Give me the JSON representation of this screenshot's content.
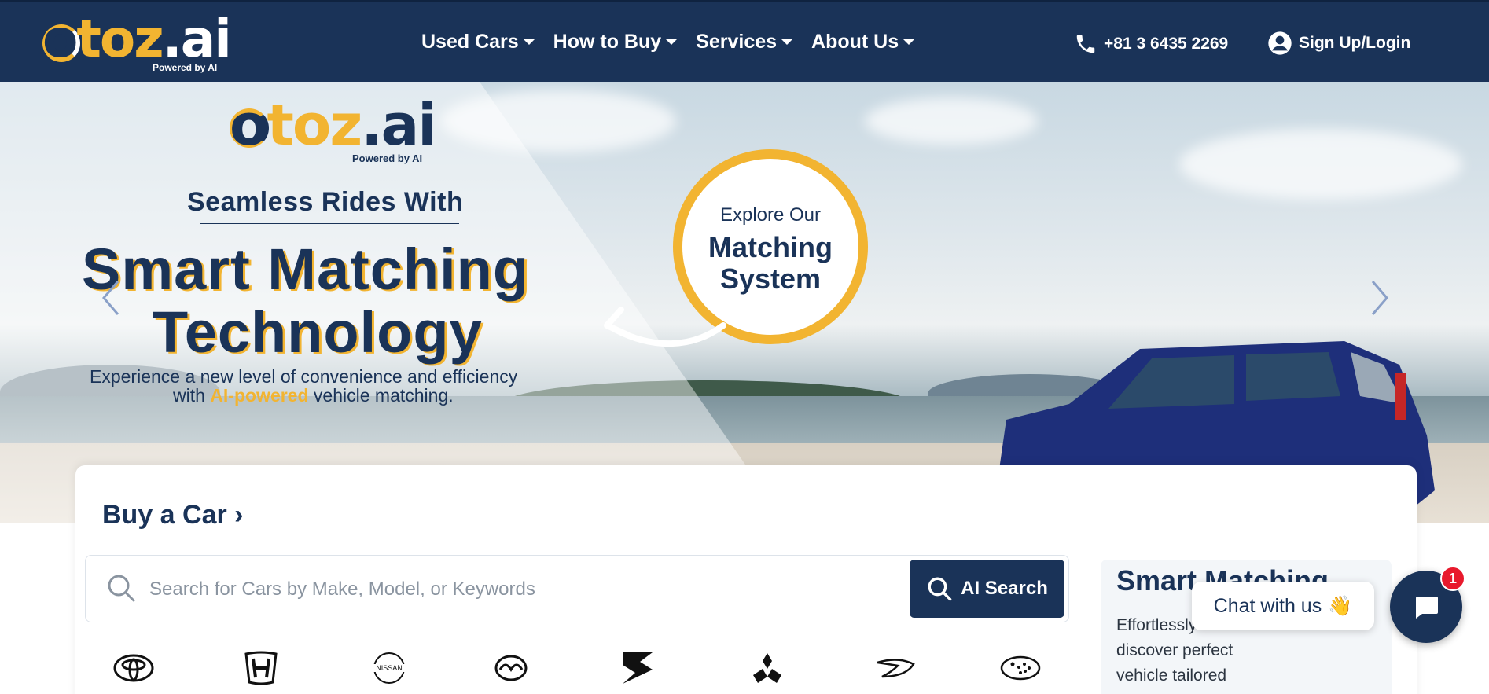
{
  "header": {
    "logo_main": "otoz.ai",
    "logo_sub": "Powered by AI",
    "nav": [
      {
        "label": "Used Cars"
      },
      {
        "label": "How to Buy"
      },
      {
        "label": "Services"
      },
      {
        "label": "About Us"
      }
    ],
    "phone": "+81 3 6435 2269",
    "login": "Sign Up/Login"
  },
  "hero": {
    "logo_main": "otoz.ai",
    "logo_sub": "Powered by AI",
    "tagline": "Seamless Rides With",
    "headline_1": "Smart Matching",
    "headline_2": "Technology",
    "desc_line1": "Experience a new level of convenience and efficiency",
    "desc_line2_pre": "with",
    "desc_line2_highlight": "AI-powered",
    "desc_line2_post": "vehicle matching.",
    "explore_top": "Explore Our",
    "explore_main_1": "Matching",
    "explore_main_2": "System"
  },
  "buy": {
    "title": "Buy a Car ›",
    "search_placeholder": "Search for Cars by Make, Model, or Keywords",
    "ai_search_label": "AI Search",
    "brands": [
      "toyota-logo",
      "honda-logo",
      "nissan-logo",
      "mazda-logo",
      "suzuki-logo",
      "mitsubishi-logo",
      "daihatsu-logo",
      "subaru-logo"
    ],
    "nissan_text": "NISSAN"
  },
  "smart_panel": {
    "title": "Smart Matching",
    "desc": "Effortlessly discover perfect vehicle tailored"
  },
  "chat": {
    "bubble_text": "Chat with us",
    "emoji": "👋",
    "badge_count": "1"
  },
  "colors": {
    "navy": "#1a3358",
    "gold": "#f2b431",
    "badge": "#e8192c"
  }
}
